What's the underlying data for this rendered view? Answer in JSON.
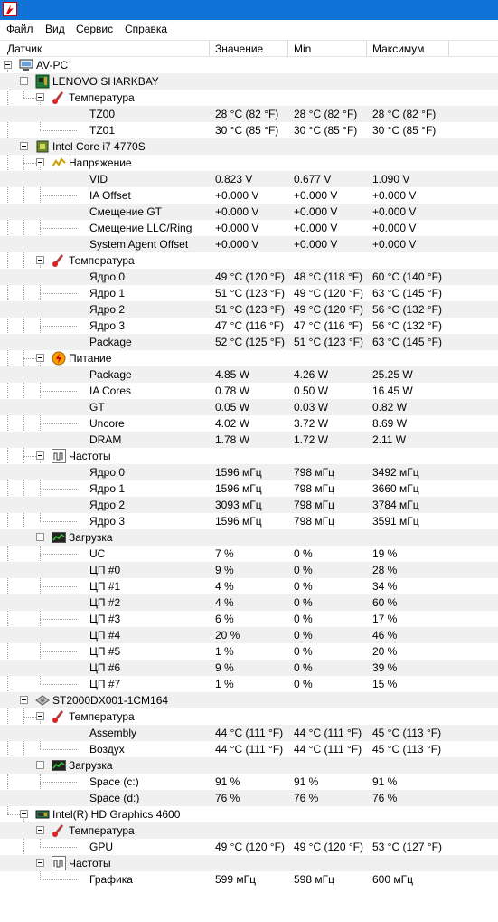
{
  "menu": [
    "Файл",
    "Вид",
    "Сервис",
    "Справка"
  ],
  "columns": {
    "sensor": "Датчик",
    "value": "Значение",
    "min": "Min",
    "max": "Максимум"
  },
  "rows": [
    {
      "level": 0,
      "icon": "computer-icon",
      "label": "AV-PC"
    },
    {
      "level": 1,
      "icon": "motherboard-icon",
      "label": "LENOVO SHARKBAY"
    },
    {
      "level": 2,
      "icon": "thermometer-icon",
      "label": "Температура"
    },
    {
      "level": 3,
      "label": "TZ00",
      "value": "28 °C  (82 °F)",
      "min": "28 °C  (82 °F)",
      "max": "28 °C  (82 °F)"
    },
    {
      "level": 3,
      "label": "TZ01",
      "value": "30 °C  (85 °F)",
      "min": "30 °C  (85 °F)",
      "max": "30 °C  (85 °F)"
    },
    {
      "level": 1,
      "icon": "cpu-icon",
      "label": "Intel Core i7 4770S"
    },
    {
      "level": 2,
      "icon": "voltage-icon",
      "label": "Напряжение"
    },
    {
      "level": 3,
      "label": "VID",
      "value": "0.823 V",
      "min": "0.677 V",
      "max": "1.090 V"
    },
    {
      "level": 3,
      "label": "IA Offset",
      "value": "+0.000 V",
      "min": "+0.000 V",
      "max": "+0.000 V"
    },
    {
      "level": 3,
      "label": "Смещение GT",
      "value": "+0.000 V",
      "min": "+0.000 V",
      "max": "+0.000 V"
    },
    {
      "level": 3,
      "label": "Смещение LLC/Ring",
      "value": "+0.000 V",
      "min": "+0.000 V",
      "max": "+0.000 V"
    },
    {
      "level": 3,
      "label": "System Agent Offset",
      "value": "+0.000 V",
      "min": "+0.000 V",
      "max": "+0.000 V"
    },
    {
      "level": 2,
      "icon": "thermometer-icon",
      "label": "Температура"
    },
    {
      "level": 3,
      "label": "Ядро 0",
      "value": "49 °C  (120 °F)",
      "min": "48 °C  (118 °F)",
      "max": "60 °C  (140 °F)"
    },
    {
      "level": 3,
      "label": "Ядро 1",
      "value": "51 °C  (123 °F)",
      "min": "49 °C  (120 °F)",
      "max": "63 °C  (145 °F)"
    },
    {
      "level": 3,
      "label": "Ядро 2",
      "value": "51 °C  (123 °F)",
      "min": "49 °C  (120 °F)",
      "max": "56 °C  (132 °F)"
    },
    {
      "level": 3,
      "label": "Ядро 3",
      "value": "47 °C  (116 °F)",
      "min": "47 °C  (116 °F)",
      "max": "56 °C  (132 °F)"
    },
    {
      "level": 3,
      "label": "Package",
      "value": "52 °C  (125 °F)",
      "min": "51 °C  (123 °F)",
      "max": "63 °C  (145 °F)"
    },
    {
      "level": 2,
      "icon": "power-icon",
      "label": "Питание"
    },
    {
      "level": 3,
      "label": "Package",
      "value": "4.85 W",
      "min": "4.26 W",
      "max": "25.25 W"
    },
    {
      "level": 3,
      "label": "IA Cores",
      "value": "0.78 W",
      "min": "0.50 W",
      "max": "16.45 W"
    },
    {
      "level": 3,
      "label": "GT",
      "value": "0.05 W",
      "min": "0.03 W",
      "max": "0.82 W"
    },
    {
      "level": 3,
      "label": "Uncore",
      "value": "4.02 W",
      "min": "3.72 W",
      "max": "8.69 W"
    },
    {
      "level": 3,
      "label": "DRAM",
      "value": "1.78 W",
      "min": "1.72 W",
      "max": "2.11 W"
    },
    {
      "level": 2,
      "icon": "frequency-icon",
      "label": "Частоты"
    },
    {
      "level": 3,
      "label": "Ядро 0",
      "value": "1596 мГц",
      "min": "798 мГц",
      "max": "3492 мГц"
    },
    {
      "level": 3,
      "label": "Ядро 1",
      "value": "1596 мГц",
      "min": "798 мГц",
      "max": "3660 мГц"
    },
    {
      "level": 3,
      "label": "Ядро 2",
      "value": "3093 мГц",
      "min": "798 мГц",
      "max": "3784 мГц"
    },
    {
      "level": 3,
      "label": "Ядро 3",
      "value": "1596 мГц",
      "min": "798 мГц",
      "max": "3591 мГц"
    },
    {
      "level": 2,
      "icon": "load-icon",
      "label": "Загрузка"
    },
    {
      "level": 3,
      "label": "UC",
      "value": "7 %",
      "min": "0 %",
      "max": "19 %"
    },
    {
      "level": 3,
      "label": "ЦП #0",
      "value": "9 %",
      "min": "0 %",
      "max": "28 %"
    },
    {
      "level": 3,
      "label": "ЦП #1",
      "value": "4 %",
      "min": "0 %",
      "max": "34 %"
    },
    {
      "level": 3,
      "label": "ЦП #2",
      "value": "4 %",
      "min": "0 %",
      "max": "60 %"
    },
    {
      "level": 3,
      "label": "ЦП #3",
      "value": "6 %",
      "min": "0 %",
      "max": "17 %"
    },
    {
      "level": 3,
      "label": "ЦП #4",
      "value": "20 %",
      "min": "0 %",
      "max": "46 %"
    },
    {
      "level": 3,
      "label": "ЦП #5",
      "value": "1 %",
      "min": "0 %",
      "max": "20 %"
    },
    {
      "level": 3,
      "label": "ЦП #6",
      "value": "9 %",
      "min": "0 %",
      "max": "39 %"
    },
    {
      "level": 3,
      "label": "ЦП #7",
      "value": "1 %",
      "min": "0 %",
      "max": "15 %"
    },
    {
      "level": 1,
      "icon": "hard-drive-icon",
      "label": "ST2000DX001-1CM164"
    },
    {
      "level": 2,
      "icon": "thermometer-icon",
      "label": "Температура"
    },
    {
      "level": 3,
      "label": "Assembly",
      "value": "44 °C  (111 °F)",
      "min": "44 °C  (111 °F)",
      "max": "45 °C  (113 °F)"
    },
    {
      "level": 3,
      "label": "Воздух",
      "value": "44 °C  (111 °F)",
      "min": "44 °C  (111 °F)",
      "max": "45 °C  (113 °F)"
    },
    {
      "level": 2,
      "icon": "load-icon",
      "label": "Загрузка"
    },
    {
      "level": 3,
      "label": "Space (c:)",
      "value": "91 %",
      "min": "91 %",
      "max": "91 %"
    },
    {
      "level": 3,
      "label": "Space (d:)",
      "value": "76 %",
      "min": "76 %",
      "max": "76 %"
    },
    {
      "level": 1,
      "icon": "gpu-icon",
      "label": "Intel(R) HD Graphics 4600"
    },
    {
      "level": 2,
      "icon": "thermometer-icon",
      "label": "Температура"
    },
    {
      "level": 3,
      "label": "GPU",
      "value": "49 °C  (120 °F)",
      "min": "49 °C  (120 °F)",
      "max": "53 °C  (127 °F)"
    },
    {
      "level": 2,
      "icon": "frequency-icon",
      "label": "Частоты"
    },
    {
      "level": 3,
      "label": "Графика",
      "value": "599 мГц",
      "min": "598 мГц",
      "max": "600 мГц"
    }
  ]
}
